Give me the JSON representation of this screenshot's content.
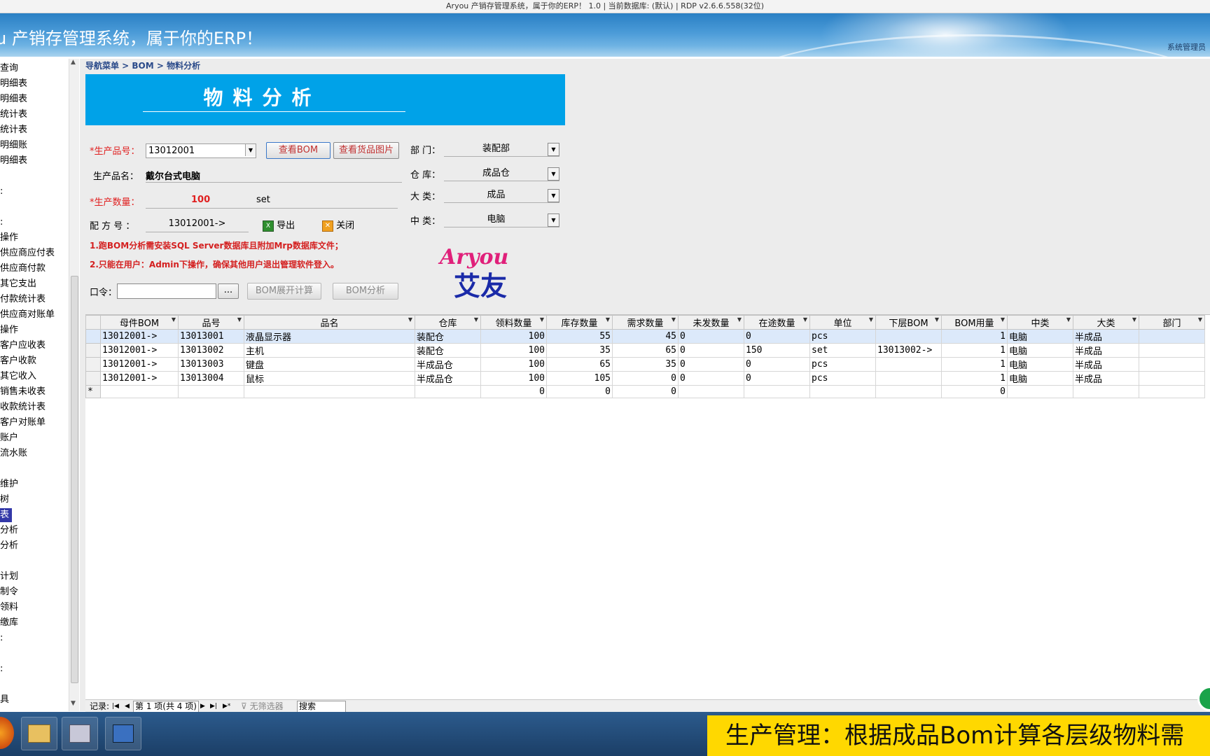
{
  "window": {
    "title": "Aryou 产销存管理系统，属于你的ERP！ 1.0 | 当前数据库: (默认) | RDP v2.6.6.558(32位)"
  },
  "banner": {
    "title": "u 产销存管理系统，属于你的ERP！",
    "user": "系统管理员"
  },
  "sidebar": {
    "items": [
      "查询",
      "明细表",
      "明细表",
      "统计表",
      "统计表",
      "明细账",
      "明细表",
      "",
      ":",
      "",
      ":",
      "操作",
      "供应商应付表",
      "供应商付款",
      "其它支出",
      "付款统计表",
      "供应商对账单",
      "操作",
      "客户应收表",
      "客户收款",
      "其它收入",
      "销售未收表",
      "收款统计表",
      "客户对账单",
      "账户",
      "流水账",
      "",
      "维护",
      "树",
      "表",
      "分析",
      "分析",
      "",
      "计划",
      "制令",
      "领料",
      "缴库",
      ":",
      "",
      ":",
      "",
      "具",
      ":"
    ],
    "selected_index": 29
  },
  "breadcrumb": "导航菜单 > BOM > 物料分析",
  "form": {
    "title": "物料分析",
    "product_no_label": "*生产品号：",
    "product_no": "13012001",
    "product_name_label": "生产品名：",
    "product_name": "戴尔台式电脑",
    "qty_label": "*生产数量：",
    "qty": "100",
    "qty_unit": "set",
    "formula_label": "配 方 号 ：",
    "formula_no": "13012001->",
    "btn_view_bom": "查看BOM",
    "btn_view_image": "查看货品图片",
    "btn_export": "导出",
    "btn_close": "关闭",
    "note1": "1.跑BOM分析需安装SQL Server数据库且附加Mrp数据库文件；",
    "note2": "2.只能在用户：Admin下操作，确保其他用户退出管理软件登入。",
    "password_label": "口令：",
    "password_value": "",
    "btn_browse": "...",
    "btn_bom_expand": "BOM展开计算",
    "btn_bom_analysis": "BOM分析",
    "dept_label": "部 门：",
    "dept": "装配部",
    "warehouse_label": "仓 库：",
    "warehouse": "成品仓",
    "category_label": "大 类：",
    "category": "成品",
    "subcategory_label": "中 类：",
    "subcategory": "电脑",
    "logo_text": "Aryou",
    "logo_cn": "艾友"
  },
  "grid": {
    "columns": [
      "母件BOM",
      "品号",
      "品名",
      "仓库",
      "领料数量",
      "库存数量",
      "需求数量",
      "未发数量",
      "在途数量",
      "单位",
      "下层BOM",
      "BOM用量",
      "中类",
      "大类",
      "部门"
    ],
    "rows": [
      [
        "13012001->",
        "13013001",
        "液晶显示器",
        "装配仓",
        "100",
        "55",
        "45",
        "0",
        "0",
        "pcs",
        "",
        "1",
        "电脑",
        "半成品",
        ""
      ],
      [
        "13012001->",
        "13013002",
        "主机",
        "装配仓",
        "100",
        "35",
        "65",
        "0",
        "150",
        "set",
        "13013002->",
        "1",
        "电脑",
        "半成品",
        ""
      ],
      [
        "13012001->",
        "13013003",
        "键盘",
        "半成品仓",
        "100",
        "65",
        "35",
        "0",
        "0",
        "pcs",
        "",
        "1",
        "电脑",
        "半成品",
        ""
      ],
      [
        "13012001->",
        "13013004",
        "鼠标",
        "半成品仓",
        "100",
        "105",
        "0",
        "0",
        "0",
        "pcs",
        "",
        "1",
        "电脑",
        "半成品",
        ""
      ]
    ],
    "new_row": [
      "",
      "",
      "",
      "",
      "0",
      "0",
      "0",
      "",
      "",
      "",
      "",
      "0",
      "",
      "",
      ""
    ],
    "new_row_marker": "*"
  },
  "navbar": {
    "record_label": "记录:",
    "position": "第 1 项(共 4 项)",
    "filter": "无筛选器",
    "search": "搜索"
  },
  "caption": "生产管理：根据成品Bom计算各层级物料需"
}
